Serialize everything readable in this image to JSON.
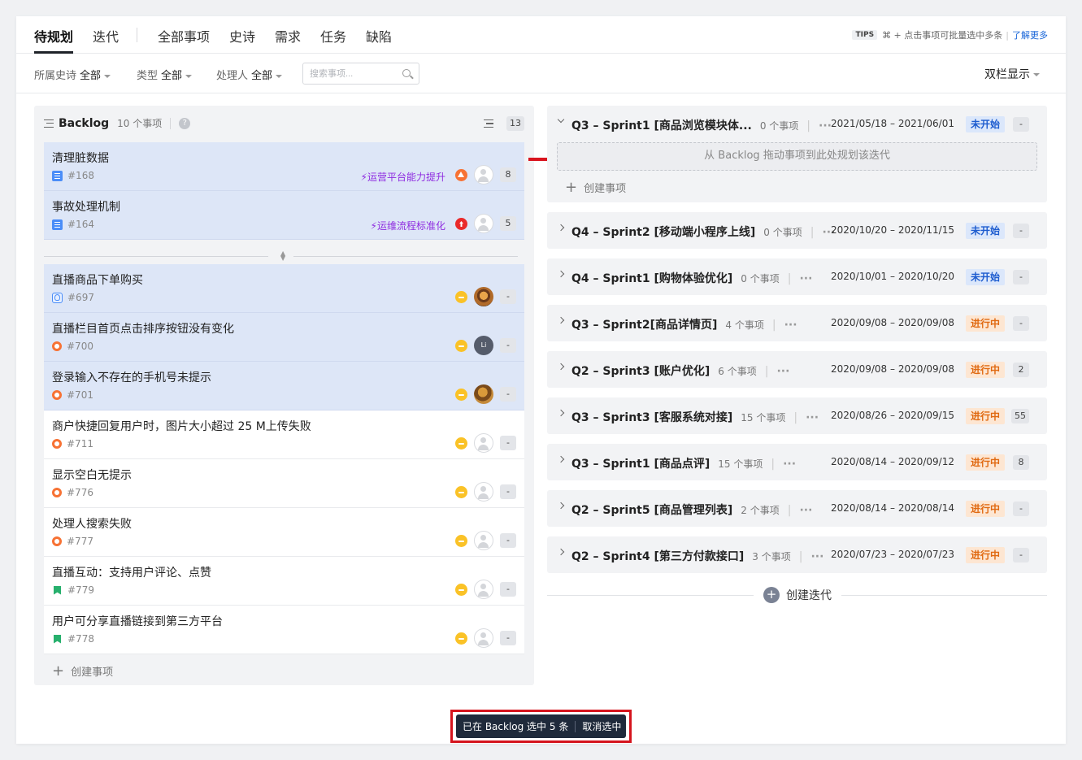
{
  "topnav": {
    "tabs": [
      "待规划",
      "迭代",
      "全部事项",
      "史诗",
      "需求",
      "任务",
      "缺陷"
    ],
    "tips": {
      "tag": "TIPS",
      "text": "⌘ + 点击事项可批量选中多条",
      "link": "了解更多"
    }
  },
  "filters": {
    "epic_label": "所属史诗",
    "epic_value": "全部",
    "type_label": "类型",
    "type_value": "全部",
    "assignee_label": "处理人",
    "assignee_value": "全部",
    "search_placeholder": "搜索事项...",
    "view_mode": "双栏显示"
  },
  "backlog": {
    "title": "Backlog",
    "count": "10 个事项",
    "badge": "13",
    "create_label": "创建事项",
    "pinned_items": [
      {
        "title": "清理脏数据",
        "id": "#168",
        "type": "story-icon",
        "epic": "运营平台能力提升",
        "priority": "high",
        "count": "8"
      },
      {
        "title": "事故处理机制",
        "id": "#164",
        "type": "story-icon",
        "epic": "运维流程标准化",
        "priority": "urgent",
        "count": "5"
      }
    ],
    "items": [
      {
        "title": "直播商品下单购买",
        "id": "#697",
        "type": "requirement-icon",
        "priority": "medium",
        "avatar": "photo",
        "count": "-",
        "selected": true
      },
      {
        "title": "直播栏目首页点击排序按钮没有变化",
        "id": "#700",
        "type": "bug-icon",
        "priority": "medium",
        "avatar": "Li",
        "count": "-",
        "selected": true
      },
      {
        "title": "登录输入不存在的手机号未提示",
        "id": "#701",
        "type": "bug-icon",
        "priority": "medium",
        "avatar": "photo",
        "count": "-",
        "selected": true
      },
      {
        "title": "商户快捷回复用户时，图片大小超过 25 M上传失败",
        "id": "#711",
        "type": "bug-icon",
        "priority": "medium",
        "avatar": "empty",
        "count": "-",
        "selected": false
      },
      {
        "title": "显示空白无提示",
        "id": "#776",
        "type": "bug-icon",
        "priority": "medium",
        "avatar": "empty",
        "count": "-",
        "selected": false
      },
      {
        "title": "处理人搜索失败",
        "id": "#777",
        "type": "bug-icon",
        "priority": "medium",
        "avatar": "empty",
        "count": "-",
        "selected": false
      },
      {
        "title": "直播互动：支持用户评论、点赞",
        "id": "#779",
        "type": "story-book-icon",
        "priority": "medium",
        "avatar": "empty",
        "count": "-",
        "selected": false
      },
      {
        "title": "用户可分享直播链接到第三方平台",
        "id": "#778",
        "type": "story-book-icon",
        "priority": "medium",
        "avatar": "empty",
        "count": "-",
        "selected": false
      }
    ]
  },
  "sprints": [
    {
      "name": "Q3 – Sprint1 [商品浏览模块体...",
      "count": "0 个事项",
      "dates": "2021/05/18 – 2021/06/01",
      "status": "未开始",
      "status_kind": "todo",
      "badge": "-",
      "expanded": true
    },
    {
      "name": "Q4 – Sprint2 [移动端小程序上线]",
      "count": "0 个事项",
      "dates": "2020/10/20 – 2020/11/15",
      "status": "未开始",
      "status_kind": "todo",
      "badge": "-"
    },
    {
      "name": "Q4 – Sprint1 [购物体验优化]",
      "count": "0 个事项",
      "dates": "2020/10/01 – 2020/10/20",
      "status": "未开始",
      "status_kind": "todo",
      "badge": "-"
    },
    {
      "name": "Q3 – Sprint2[商品详情页]",
      "count": "4 个事项",
      "dates": "2020/09/08 – 2020/09/08",
      "status": "进行中",
      "status_kind": "doing",
      "badge": "-"
    },
    {
      "name": "Q2 – Sprint3 [账户优化]",
      "count": "6 个事项",
      "dates": "2020/09/08 – 2020/09/08",
      "status": "进行中",
      "status_kind": "doing",
      "badge": "2"
    },
    {
      "name": "Q3 – Sprint3 [客服系统对接]",
      "count": "15 个事项",
      "dates": "2020/08/26 – 2020/09/15",
      "status": "进行中",
      "status_kind": "doing",
      "badge": "55"
    },
    {
      "name": "Q3 – Sprint1 [商品点评]",
      "count": "15 个事项",
      "dates": "2020/08/14 – 2020/09/12",
      "status": "进行中",
      "status_kind": "doing",
      "badge": "8"
    },
    {
      "name": "Q2 – Sprint5 [商品管理列表]",
      "count": "2 个事项",
      "dates": "2020/08/14 – 2020/08/14",
      "status": "进行中",
      "status_kind": "doing",
      "badge": "-"
    },
    {
      "name": "Q2 – Sprint4 [第三方付款接口]",
      "count": "3 个事项",
      "dates": "2020/07/23 – 2020/07/23",
      "status": "进行中",
      "status_kind": "doing",
      "badge": "-"
    }
  ],
  "dropzone_text": "从 Backlog 拖动事项到此处规划该迭代",
  "sprint_create_label": "创建事项",
  "create_iteration_label": "创建迭代",
  "toast": {
    "text": "已在 Backlog 选中 5 条",
    "action": "取消选中"
  },
  "colors": {
    "accent": "#1664d8",
    "selection": "#dde6f7",
    "todo": "#1d5ccf",
    "doing": "#e06a12",
    "annotation": "#d9141e"
  }
}
